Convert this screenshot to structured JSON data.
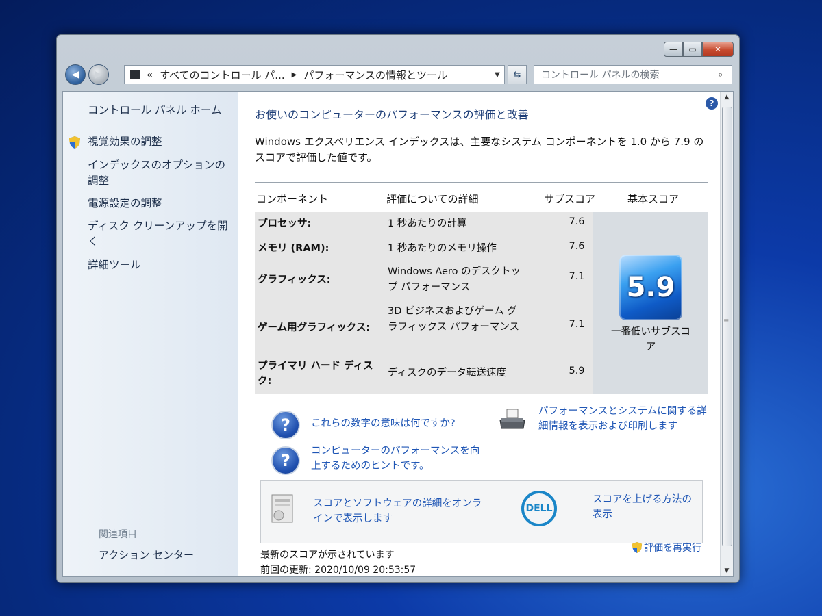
{
  "window": {
    "min_glyph": "—",
    "max_glyph": "▭",
    "close_glyph": "✕"
  },
  "address": {
    "chevron": "«",
    "crumb1": "すべてのコントロール パ...",
    "crumb2": "パフォーマンスの情報とツール"
  },
  "search": {
    "placeholder": "コントロール パネルの検索"
  },
  "sidebar": {
    "home": "コントロール パネル ホーム",
    "items": [
      "視覚効果の調整",
      "インデックスのオプションの調整",
      "電源設定の調整",
      "ディスク クリーンアップを開く",
      "詳細ツール"
    ],
    "related_title": "関連項目",
    "action_center": "アクション センター"
  },
  "main": {
    "title": "お使いのコンピューターのパフォーマンスの評価と改善",
    "description": "Windows エクスペリエンス インデックスは、主要なシステム コンポーネントを 1.0 から 7.9 のスコアで評価した値です。",
    "table": {
      "headers": {
        "component": "コンポーネント",
        "details": "評価についての詳細",
        "subscore": "サブスコア",
        "base_score": "基本スコア"
      },
      "rows": [
        {
          "component": "プロセッサ:",
          "details": "1 秒あたりの計算",
          "subscore": "7.6"
        },
        {
          "component": "メモリ (RAM):",
          "details": "1 秒あたりのメモリ操作",
          "subscore": "7.6"
        },
        {
          "component": "グラフィックス:",
          "details": "Windows Aero のデスクトップ パフォーマンス",
          "subscore": "7.1"
        },
        {
          "component": "ゲーム用グラフィックス:",
          "details": "3D ビジネスおよびゲーム グラフィックス パフォーマンス",
          "subscore": "7.1"
        },
        {
          "component": "プライマリ ハード ディスク:",
          "details": "ディスクのデータ転送速度",
          "subscore": "5.9"
        }
      ],
      "base_score": "5.9",
      "base_caption": "一番低いサブスコア"
    },
    "links": {
      "meaning": "これらの数字の意味は何ですか?",
      "tips": "コンピューターのパフォーマンスを向上するためのヒントです。",
      "print": "パフォーマンスとシステムに関する詳細情報を表示および印刷します",
      "online": "スコアとソフトウェアの詳細をオンラインで表示します",
      "dell_logo": "DELL",
      "raise": "スコアを上げる方法の表示",
      "rerun": "評価を再実行"
    },
    "status": {
      "current": "最新のスコアが示されています",
      "last_update": "前回の更新: 2020/10/09 20:53:57"
    }
  }
}
